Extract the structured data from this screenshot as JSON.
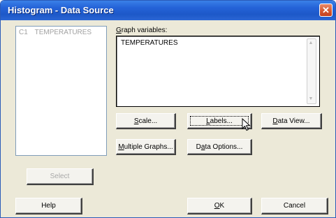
{
  "window": {
    "title": "Histogram - Data Source",
    "close_glyph": "✕"
  },
  "variables_list": {
    "items": [
      {
        "id": "C1",
        "name": "TEMPERATURES"
      }
    ]
  },
  "graph_variables": {
    "label_pre": "",
    "label_ul": "G",
    "label_post": "raph variables:",
    "value": "TEMPERATURES",
    "scroll_up_glyph": "▲",
    "scroll_down_glyph": "▼"
  },
  "buttons": {
    "scale": {
      "pre": "",
      "ul": "S",
      "post": "cale..."
    },
    "labels": {
      "pre": "",
      "ul": "L",
      "post": "abels..."
    },
    "data_view": {
      "pre": "",
      "ul": "D",
      "post": "ata View..."
    },
    "multiple_graphs": {
      "pre": "",
      "ul": "M",
      "post": "ultiple Graphs..."
    },
    "data_options": {
      "pre": "D",
      "ul": "a",
      "post": "ta Options..."
    },
    "select": {
      "label": "Select"
    },
    "help": {
      "label": "Help"
    },
    "ok": {
      "pre": "",
      "ul": "O",
      "post": "K"
    },
    "cancel": {
      "label": "Cancel"
    }
  },
  "colors": {
    "titlebar": "#2563d8",
    "dialog_bg": "#ece9d8",
    "close_button": "#d4552d"
  },
  "icons": {
    "close": "close-icon",
    "cursor": "arrow-cursor-icon"
  }
}
